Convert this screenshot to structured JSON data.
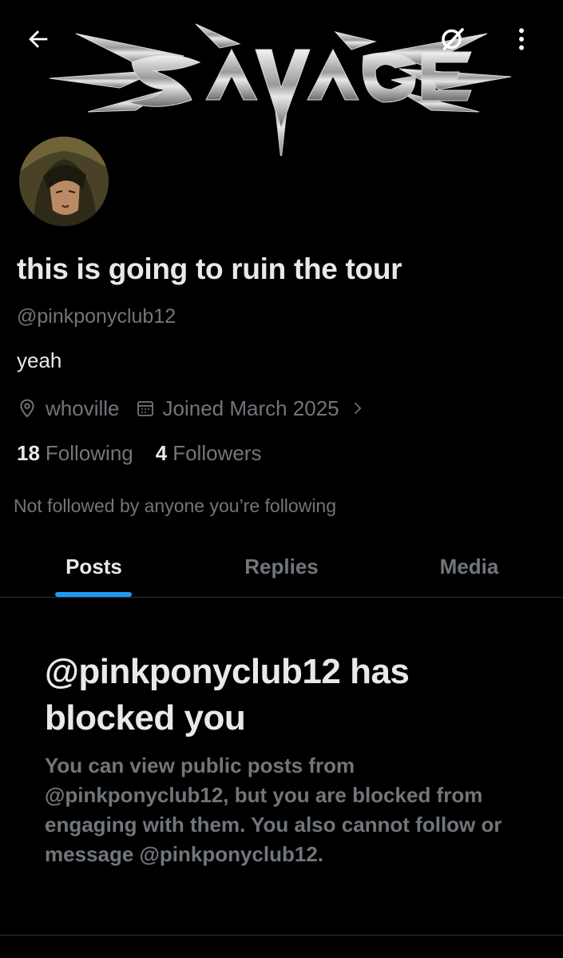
{
  "header": {
    "back_icon": "arrow-left-icon",
    "search_icon": "search-icon",
    "more_icon": "more-vertical-icon"
  },
  "banner": {
    "wordmark": "SAVAGE"
  },
  "profile": {
    "display_name": "this is going to ruin the tour",
    "handle": "@pinkponyclub12",
    "bio": "yeah",
    "location": "whoville",
    "joined": "Joined March 2025",
    "following_count": "18",
    "following_label": "Following",
    "followers_count": "4",
    "followers_label": "Followers",
    "followed_by": "Not followed by anyone you’re following"
  },
  "tabs": [
    {
      "label": "Posts",
      "active": true
    },
    {
      "label": "Replies",
      "active": false
    },
    {
      "label": "Media",
      "active": false
    }
  ],
  "blocked": {
    "title": "@pinkponyclub12 has blocked you",
    "message": "You can view public posts from @pinkponyclub12, but you are blocked from engaging with them. You also cannot follow or message @pinkponyclub12."
  },
  "colors": {
    "background": "#000000",
    "text_primary": "#e7e9ea",
    "text_secondary": "#71767b",
    "accent": "#1d9bf0",
    "divider": "#2f3336"
  }
}
